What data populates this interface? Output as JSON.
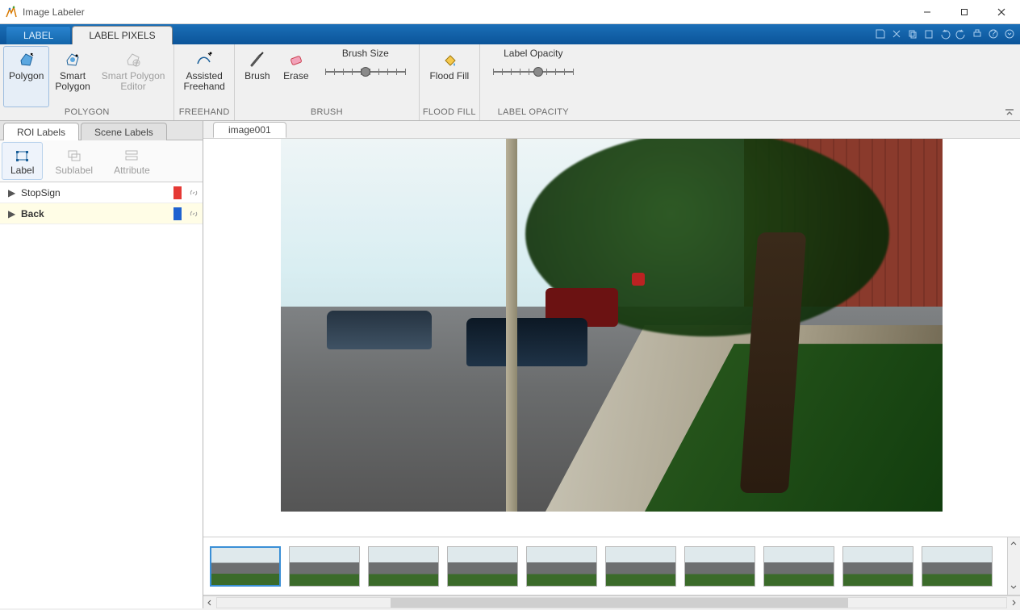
{
  "window": {
    "title": "Image Labeler"
  },
  "tabs": {
    "label": "LABEL",
    "label_pixels": "LABEL PIXELS"
  },
  "ribbon": {
    "polygon": {
      "group": "POLYGON",
      "polygon": "Polygon",
      "smart_polygon": "Smart\nPolygon",
      "smart_polygon_editor": "Smart Polygon\nEditor"
    },
    "freehand": {
      "group": "FREEHAND",
      "assisted_freehand": "Assisted\nFreehand"
    },
    "brush": {
      "group": "BRUSH",
      "brush": "Brush",
      "erase": "Erase",
      "brush_size": "Brush Size"
    },
    "flood": {
      "group": "FLOOD FILL",
      "flood_fill": "Flood Fill"
    },
    "opacity": {
      "group": "LABEL OPACITY",
      "label_opacity": "Label Opacity"
    }
  },
  "left": {
    "tabs": {
      "roi": "ROI Labels",
      "scene": "Scene Labels"
    },
    "buttons": {
      "label": "Label",
      "sublabel": "Sublabel",
      "attribute": "Attribute"
    },
    "labels": [
      {
        "name": "StopSign",
        "color": "#e53935",
        "selected": false
      },
      {
        "name": "Back",
        "color": "#1e62d0",
        "selected": true
      }
    ]
  },
  "doc": {
    "tab": "image001"
  },
  "thumbnails": {
    "count": 10,
    "selected_index": 0
  }
}
